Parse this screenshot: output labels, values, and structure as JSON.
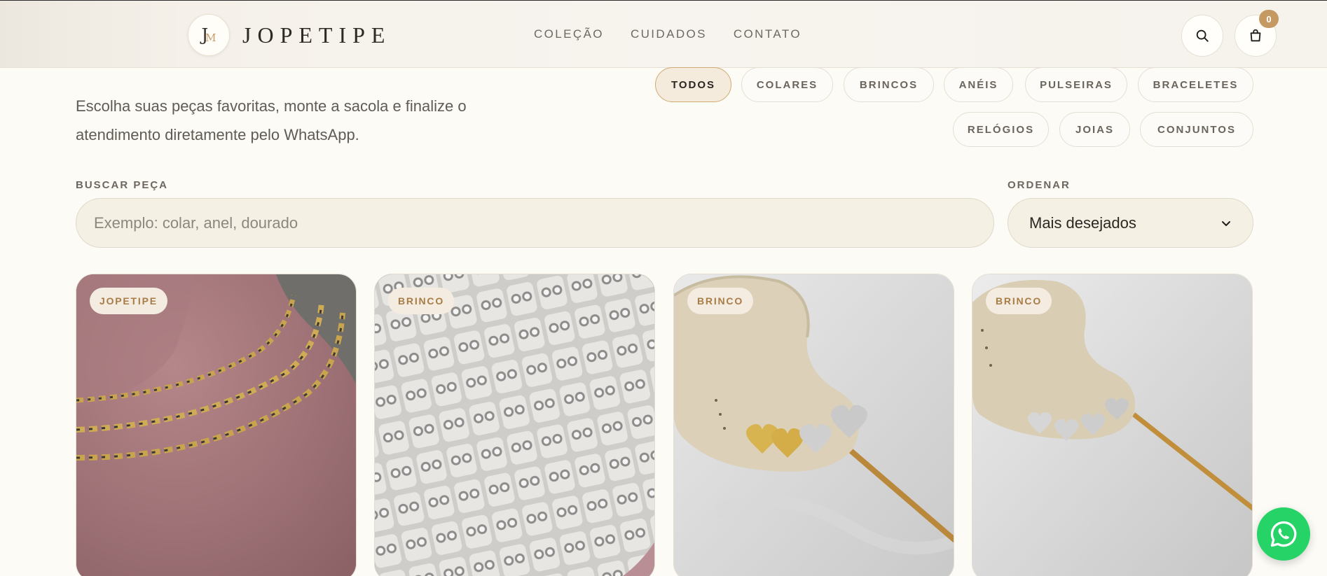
{
  "header": {
    "logo_monogram": "JM",
    "brand_name": "JOPETIPE",
    "nav": [
      "COLEÇÃO",
      "CUIDADOS",
      "CONTATO"
    ],
    "cart_count": "0",
    "search_icon": "search-icon",
    "bag_icon": "shopping-bag-icon"
  },
  "intro": {
    "text": "Escolha suas peças favoritas, monte a sacola e finalize o atendimento diretamente pelo WhatsApp."
  },
  "filters": {
    "active": "TODOS",
    "chips": [
      "TODOS",
      "COLARES",
      "BRINCOS",
      "ANÉIS",
      "PULSEIRAS",
      "BRACELETES",
      "RELÓGIOS",
      "JOIAS",
      "CONJUNTOS"
    ]
  },
  "search": {
    "label": "BUSCAR PEÇA",
    "placeholder": "Exemplo: colar, anel, dourado",
    "value": ""
  },
  "sort": {
    "label": "ORDENAR",
    "selected": "Mais desejados",
    "icon": "chevron-down-icon"
  },
  "products": [
    {
      "badge": "JOPETIPE",
      "image": "layered-gold-silver-necklaces-on-pink-bust"
    },
    {
      "badge": "BRINCO",
      "image": "tray-of-crystal-stud-earrings"
    },
    {
      "badge": "BRINCO",
      "image": "gold-and-silver-heart-studs-on-ear-display"
    },
    {
      "badge": "BRINCO",
      "image": "crystal-heart-studs-on-ear-display"
    }
  ],
  "colors": {
    "background": "#fcfbf6",
    "accent_gold": "#c49a62",
    "whatsapp_green": "#25d366"
  },
  "floating": {
    "whatsapp_icon": "whatsapp-icon"
  }
}
